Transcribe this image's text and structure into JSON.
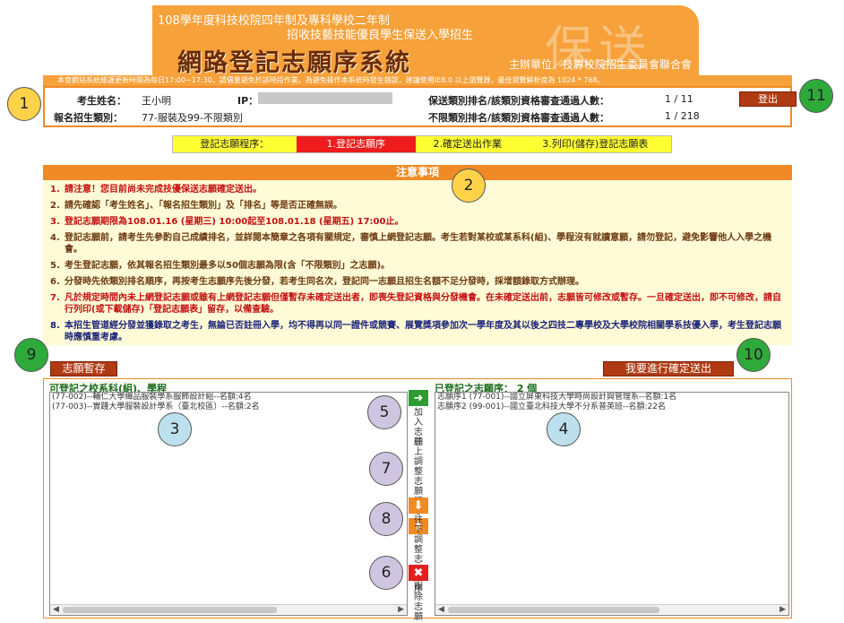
{
  "header": {
    "line1": "108學年度科技校院四年制及專科學校二年制",
    "line2": "招收技藝技能優良學生保送入學招生",
    "title": "網路登記志願序系統",
    "watermark": "保送",
    "host": "主辦單位／技專校院招生委員會聯合會",
    "notice": "本會網站系統維護更新時間為每日17:00~17:30，請儘量避免於該時段作業。為避免操作本系統時發生錯誤，建議使用IE8.0 以上瀏覽器，最佳瀏覽解析度為 1024 * 768。"
  },
  "info": {
    "name_label": "考生姓名：",
    "name_value": "王小明",
    "ip_label": "IP：",
    "category_label": "報名招生類別：",
    "category_value": "77-服裝及99-不限類別",
    "rank_label": "保送類別排名/該類別資格審查通過人數：",
    "rank_value": "1 / 11",
    "rank2_label": "不限類別排名/該類別資格審查通過人數：",
    "rank2_value": "1 / 218",
    "logout": "登出"
  },
  "steps": {
    "label": "登記志願程序：",
    "step1": "1.登記志願序",
    "step2": "2.確定送出作業",
    "step3": "3.列印(儲存)登記志願表"
  },
  "notes": {
    "title": "注意事項",
    "items": [
      {
        "n": "1.",
        "text": "請注意！您目前尚未完成技優保送志願確定送出。"
      },
      {
        "n": "2.",
        "text": "請先確認「考生姓名」、「報名招生類別」及「排名」等是否正確無誤。"
      },
      {
        "n": "3.",
        "text": "登記志願期限為108.01.16 (星期三) 10:00起至108.01.18 (星期五) 17:00止。"
      },
      {
        "n": "4.",
        "text": "登記志願前，請考生先參酌自己成績排名，並詳閱本簡章之各項有關規定，審慎上網登記志願。考生若對某校或某系科(組)、學程沒有就讀意願，請勿登記，避免影響他人入學之機會。"
      },
      {
        "n": "5.",
        "text": "考生登記志願，依其報名招生類別最多以50個志願為限(含「不限類別」之志願)。"
      },
      {
        "n": "6.",
        "text": "分發時先依類別排名順序，再按考生志願序先後分發，若考生同名次，登記同一志願且招生名額不足分發時，採增額錄取方式辦理。"
      },
      {
        "n": "7.",
        "text": "凡於規定時間內未上網登記志願或雖有上網登記志願但僅暫存未確定送出者，即喪失登記資格與分發機會。在未確定送出前，志願皆可修改或暫存。一旦確定送出，即不可修改，請自行列印(或下載儲存)「登記志願表」留存，以備查驗。"
      },
      {
        "n": "8.",
        "text": "本招生管道經分發並獲錄取之考生，無論已否註冊入學，均不得再以同一證件或競賽、展覽獎項參加次一學年度及其以後之四技二專學校及大學校院相關學系技優入學，考生登記志願時應慎重考慮。"
      }
    ]
  },
  "buttons": {
    "save": "志願暫存",
    "confirm": "我要進行確定送出"
  },
  "available": {
    "title": "可登記之校系科(組)、學程",
    "rows": [
      "(77-002)--輔仁大學織品服裝學系服飾設計組--名額:4名",
      "(77-003)--實踐大學服裝設計學系（臺北校區）--名額:2名"
    ]
  },
  "selected": {
    "title": "已登記之志願序： 2  個",
    "rows": [
      "志願序1 (77-001)--國立屏東科技大學時尚設計與管理系--名額:1名",
      "志願序2 (99-001)--國立臺北科技大學不分系普英班--名額:22名"
    ]
  },
  "controls": {
    "add": "加入志願",
    "up": "往上調整志願順序",
    "down": "往下調整志願順序",
    "remove": "刪除志願"
  },
  "callouts": [
    "1",
    "2",
    "3",
    "4",
    "5",
    "6",
    "7",
    "8",
    "9",
    "10",
    "11"
  ]
}
